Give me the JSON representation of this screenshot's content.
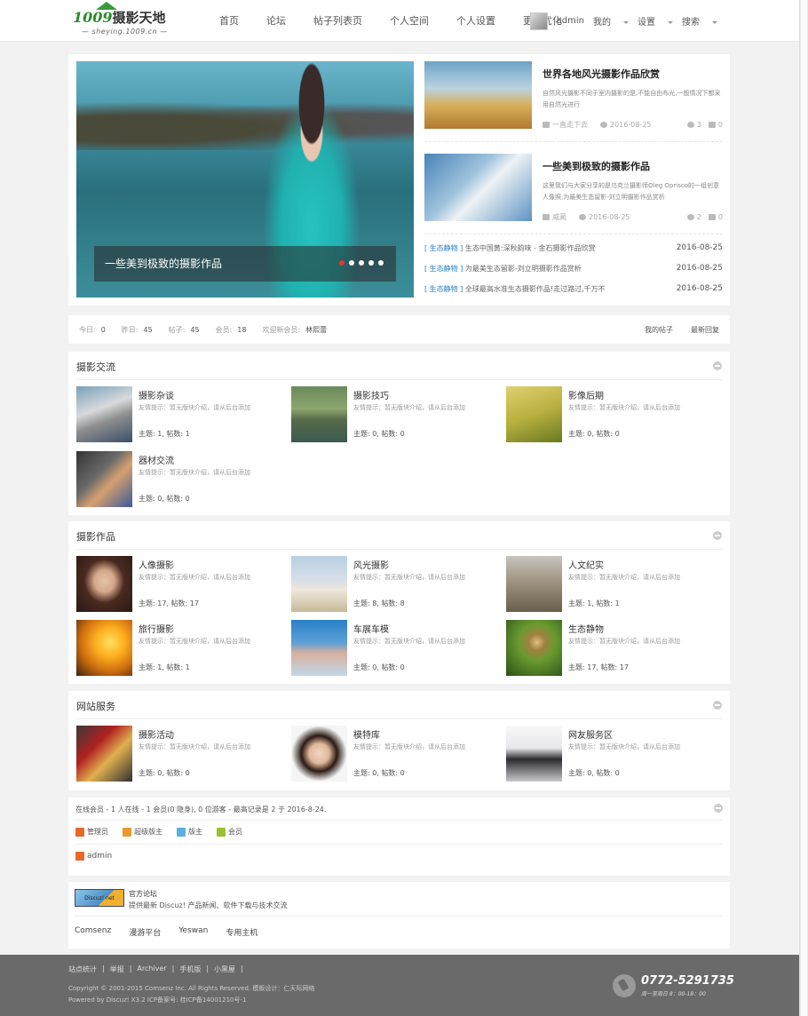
{
  "header": {
    "logo_main": "1009",
    "logo_cn": "摄影天地",
    "logo_sub": "— sheying.1009.cn —",
    "nav": [
      "首页",
      "论坛",
      "帖子列表页",
      "个人空间",
      "个人设置",
      "更多优化"
    ],
    "username": "admin",
    "menu_mine": "我的",
    "menu_settings": "设置",
    "menu_search": "搜索"
  },
  "hero": {
    "slide_caption": "一些美到极致的摄影作品",
    "featured": [
      {
        "title": "世界各地风光摄影作品欣赏",
        "desc": "自然风光摄影不同于室内摄影的是,不能自由布光,一般情况下都采用自然光进行",
        "author": "一直走下去",
        "date": "2016-08-25",
        "views": "3",
        "replies": "0"
      },
      {
        "title": "一些美到极致的摄影作品",
        "desc": "这里我们与大家分享的是乌克兰摄影师Oleg Oprisco的一组创意人像照,为最美生态留影-刘立明摄影作品赏析",
        "author": "威蔺",
        "date": "2016-08-25",
        "views": "2",
        "replies": "0"
      }
    ],
    "recent": [
      {
        "cat": "[ 生态静物 ]",
        "title": "生态中国黄:深秋韵味 - 金石摄影作品欣赏",
        "date": "2016-08-25"
      },
      {
        "cat": "[ 生态静物 ]",
        "title": "为最美生态留影-刘立明摄影作品赏析",
        "date": "2016-08-25"
      },
      {
        "cat": "[ 生态静物 ]",
        "title": "全球最高水准生态摄影作品!走过路过,千万不",
        "date": "2016-08-25"
      }
    ]
  },
  "stats": {
    "today_label": "今日:",
    "today": "0",
    "yesterday_label": "昨日:",
    "yesterday": "45",
    "posts_label": "帖子:",
    "posts": "45",
    "members_label": "会员:",
    "members": "18",
    "newest_label": "欢迎新会员:",
    "newest": "林熙蕾",
    "my_posts": "我的帖子",
    "latest_replies": "最新回复"
  },
  "sections": [
    {
      "title": "摄影交流",
      "forums": [
        {
          "name": "摄影杂谈",
          "desc": "友情提示：暂无版块介绍，请从后台添加",
          "stat": "主题: 1, 帖数: 1"
        },
        {
          "name": "摄影技巧",
          "desc": "友情提示：暂无版块介绍，请从后台添加",
          "stat": "主题: 0, 帖数: 0"
        },
        {
          "name": "影像后期",
          "desc": "友情提示：暂无版块介绍，请从后台添加",
          "stat": "主题: 0, 帖数: 0"
        },
        {
          "name": "器材交流",
          "desc": "友情提示：暂无版块介绍，请从后台添加",
          "stat": "主题: 0, 帖数: 0"
        }
      ]
    },
    {
      "title": "摄影作品",
      "forums": [
        {
          "name": "人像摄影",
          "desc": "友情提示：暂无版块介绍，请从后台添加",
          "stat": "主题: 17, 帖数: 17"
        },
        {
          "name": "风光摄影",
          "desc": "友情提示：暂无版块介绍，请从后台添加",
          "stat": "主题: 8, 帖数: 8"
        },
        {
          "name": "人文纪实",
          "desc": "友情提示：暂无版块介绍，请从后台添加",
          "stat": "主题: 1, 帖数: 1"
        },
        {
          "name": "旅行摄影",
          "desc": "友情提示：暂无版块介绍，请从后台添加",
          "stat": "主题: 1, 帖数: 1"
        },
        {
          "name": "车展车模",
          "desc": "友情提示：暂无版块介绍，请从后台添加",
          "stat": "主题: 0, 帖数: 0"
        },
        {
          "name": "生态静物",
          "desc": "友情提示：暂无版块介绍，请从后台添加",
          "stat": "主题: 17, 帖数: 17"
        }
      ]
    },
    {
      "title": "网站服务",
      "forums": [
        {
          "name": "摄影活动",
          "desc": "友情提示：暂无版块介绍，请从后台添加",
          "stat": "主题: 0, 帖数: 0"
        },
        {
          "name": "模特库",
          "desc": "友情提示：暂无版块介绍，请从后台添加",
          "stat": "主题: 0, 帖数: 0"
        },
        {
          "name": "网友服务区",
          "desc": "友情提示：暂无版块介绍，请从后台添加",
          "stat": "主题: 0, 帖数: 0"
        }
      ]
    }
  ],
  "online": {
    "summary": "在线会员 - 1 人在线 - 1 会员(0 隐身), 0 位游客 - 最高记录是 2 于 2016-8-24.",
    "legend": [
      {
        "label": "管理员",
        "color": "#e8682a"
      },
      {
        "label": "超级版主",
        "color": "#e89a2a"
      },
      {
        "label": "版主",
        "color": "#5ab0e0"
      },
      {
        "label": "会员",
        "color": "#9ac030"
      }
    ],
    "user": "admin"
  },
  "friend_links": {
    "badge": "Discuz! net",
    "title": "官方论坛",
    "desc": "提供最新 Discuz! 产品新闻、软件下载与技术交流",
    "links": [
      "Comsenz",
      "漫游平台",
      "Yeswan",
      "专用主机"
    ]
  },
  "footer": {
    "nav": [
      "站点统计",
      "|",
      "举报",
      "|",
      "Archiver",
      "|",
      "手机版",
      "|",
      "小黑屋",
      "|"
    ],
    "copyright": "Copyright © 2001-2015 Comsenz Inc. All Rights Reserved.   模板设计：仁天际网络",
    "powered": "Powered by Discuz! X3.2   ICP备案号: 桂ICP备14001210号-1",
    "phone": "0772-5291735",
    "hours": "周一至周日  8：00-18：00"
  }
}
